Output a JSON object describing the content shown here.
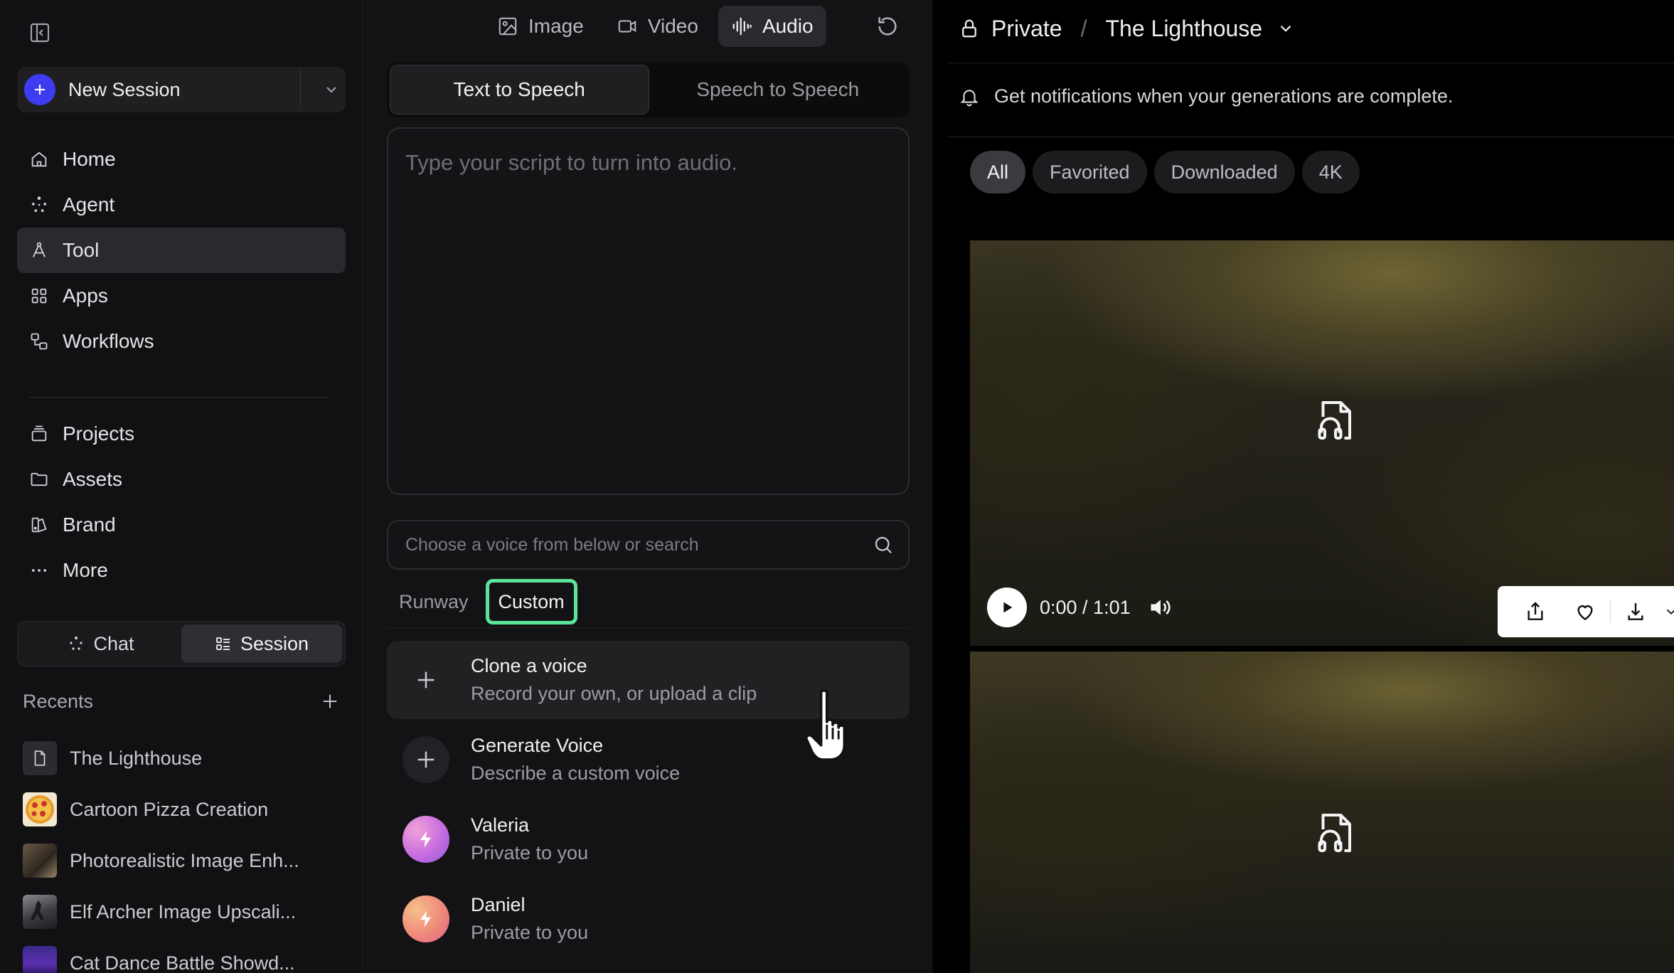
{
  "sidebar": {
    "new_session_label": "New Session",
    "nav": [
      {
        "label": "Home",
        "icon": "home-icon"
      },
      {
        "label": "Agent",
        "icon": "agent-icon"
      },
      {
        "label": "Tool",
        "icon": "tool-icon",
        "active": true
      },
      {
        "label": "Apps",
        "icon": "apps-icon"
      },
      {
        "label": "Workflows",
        "icon": "workflows-icon"
      },
      {
        "label": "Projects",
        "icon": "projects-icon"
      },
      {
        "label": "Assets",
        "icon": "folder-icon"
      },
      {
        "label": "Brand",
        "icon": "brand-icon"
      },
      {
        "label": "More",
        "icon": "more-icon"
      }
    ],
    "toggle": {
      "chat": "Chat",
      "session": "Session",
      "active": "session"
    },
    "recents_title": "Recents",
    "recents": [
      {
        "name": "The Lighthouse",
        "thumb": "document-icon"
      },
      {
        "name": "Cartoon Pizza Creation",
        "thumb": "pizza-thumbnail"
      },
      {
        "name": "Photorealistic Image Enh...",
        "thumb": "photo-thumbnail"
      },
      {
        "name": "Elf Archer Image Upscali...",
        "thumb": "archer-thumbnail"
      },
      {
        "name": "Cat Dance Battle Showd...",
        "thumb": "cat-thumbnail"
      }
    ]
  },
  "middle": {
    "modes": [
      {
        "label": "Image",
        "icon": "image-icon"
      },
      {
        "label": "Video",
        "icon": "video-icon"
      },
      {
        "label": "Audio",
        "icon": "audio-wave-icon",
        "active": true
      }
    ],
    "segments": {
      "tts": "Text to Speech",
      "sts": "Speech to Speech",
      "active": "tts"
    },
    "script_placeholder": "Type your script to turn into audio.",
    "voice_search_placeholder": "Choose a voice from below or search",
    "voice_tabs": {
      "runway": "Runway",
      "custom": "Custom",
      "active": "custom"
    },
    "voices": [
      {
        "title": "Clone a voice",
        "subtitle": "Record your own, or upload a clip",
        "kind": "plus"
      },
      {
        "title": "Generate Voice",
        "subtitle": "Describe a custom voice",
        "kind": "plus"
      },
      {
        "title": "Valeria",
        "subtitle": "Private to you",
        "kind": "avatar",
        "color": "#c86de0"
      },
      {
        "title": "Daniel",
        "subtitle": "Private to you",
        "kind": "avatar",
        "color": "#ef8a7a"
      }
    ]
  },
  "right": {
    "privacy": "Private",
    "separator": "/",
    "project": "The Lighthouse",
    "notice": "Get notifications when your generations are complete.",
    "filters": [
      {
        "label": "All",
        "active": true
      },
      {
        "label": "Favorited"
      },
      {
        "label": "Downloaded"
      },
      {
        "label": "4K"
      }
    ],
    "player": {
      "time": "0:00 / 1:01"
    }
  }
}
